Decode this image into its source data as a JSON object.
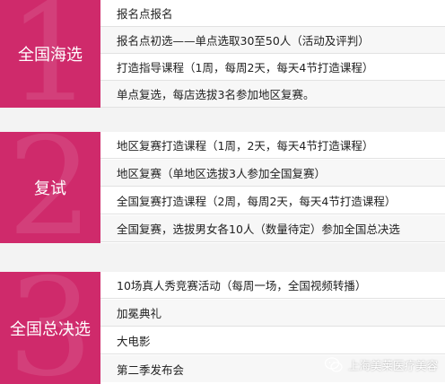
{
  "theme": {
    "accent": "#cf2a6b",
    "background": "#f3f3f3"
  },
  "sections": [
    {
      "title": "全国海选",
      "number": "1",
      "items": [
        "报名点报名",
        "报名点初选——单点选取30至50人（活动及评判）",
        "打造指导课程（1周，每周2天，每天4节打造课程）",
        "单点复选，每店选拔3名参加地区复赛。"
      ]
    },
    {
      "title": "复试",
      "number": "2",
      "items": [
        "地区复赛打造课程（1周，2天，每天4节打造课程）",
        "地区复赛（单地区选拔3人参加全国复赛）",
        "全国复赛打造课程（2周，每周2天，每天4节打造课程）",
        "全国复赛，选拔男女各10人（数量待定）参加全国总决选"
      ]
    },
    {
      "title": "全国总决选",
      "number": "3",
      "items": [
        "10场真人秀竞赛活动（每周一场，全国视频转播）",
        "加冕典礼",
        "大电影",
        "第二季发布会"
      ]
    }
  ],
  "watermark": {
    "text": "上海美莱医疗美容",
    "icon": "wechat-icon"
  }
}
